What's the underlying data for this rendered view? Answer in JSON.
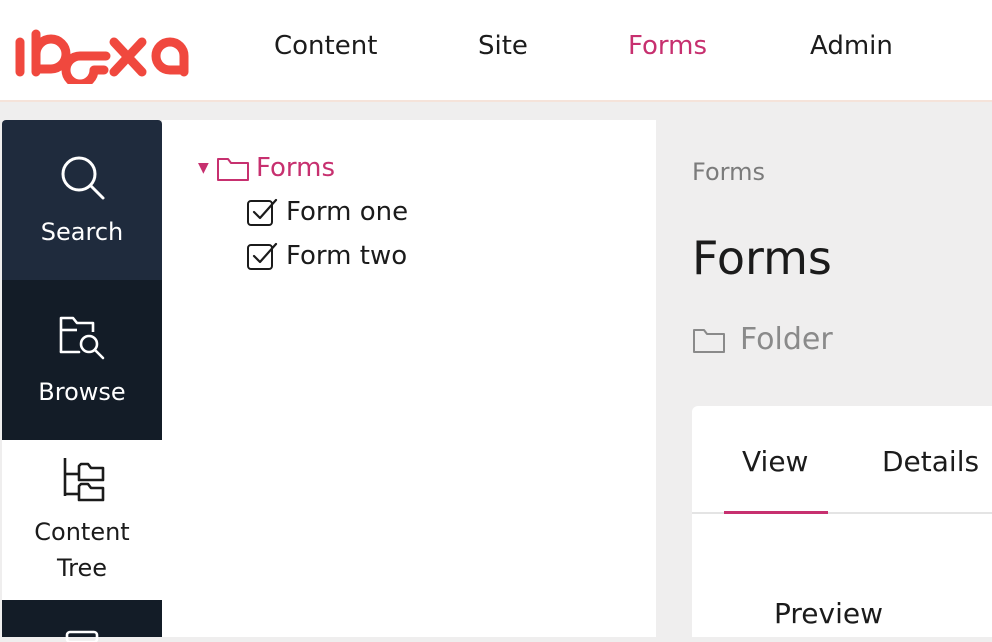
{
  "brand": {
    "logo_text": "ibexa",
    "accent_color": "#c7306f",
    "logo_color": "#f0483e"
  },
  "nav": {
    "items": [
      {
        "label": "Content",
        "active": false
      },
      {
        "label": "Site",
        "active": false
      },
      {
        "label": "Forms",
        "active": true
      },
      {
        "label": "Admin",
        "active": false
      }
    ]
  },
  "rail": {
    "search_label": "Search",
    "browse_label": "Browse",
    "tree_label_line1": "Content",
    "tree_label_line2": "Tree",
    "icons": [
      "search-icon",
      "folder-search-icon",
      "content-tree-icon",
      "list-icon"
    ]
  },
  "tree": {
    "root": {
      "label": "Forms",
      "icon": "folder-icon",
      "expanded": true
    },
    "children": [
      {
        "label": "Form one",
        "icon": "form-checkbox-icon"
      },
      {
        "label": "Form two",
        "icon": "form-checkbox-icon"
      }
    ]
  },
  "main": {
    "breadcrumb": "Forms",
    "title": "Forms",
    "content_type": "Folder",
    "tabs": [
      {
        "label": "View",
        "active": true
      },
      {
        "label": "Details",
        "active": false
      }
    ],
    "section_title": "Preview"
  }
}
